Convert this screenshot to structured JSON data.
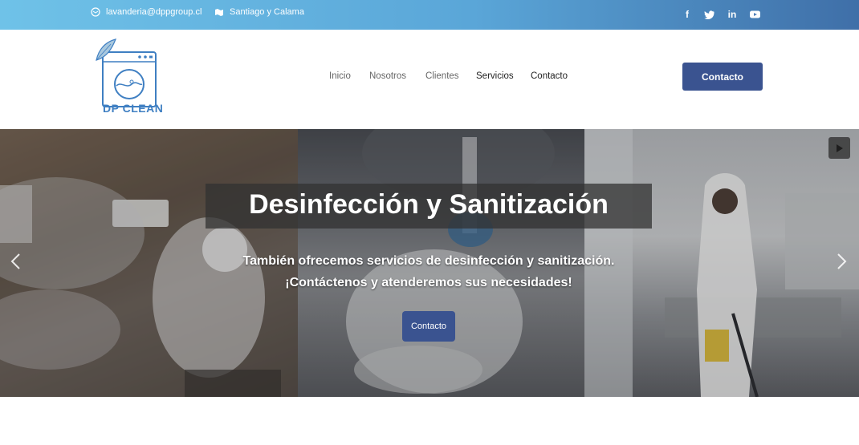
{
  "topbar": {
    "email": "lavanderia@dppgroup.cl",
    "location": "Santiago y Calama",
    "social": [
      "facebook-icon",
      "twitter-icon",
      "linkedin-icon",
      "youtube-icon"
    ]
  },
  "header": {
    "logo_text": "DP CLEAN",
    "nav": [
      "Inicio",
      "Nosotros",
      "Clientes",
      "Servicios",
      "Contacto"
    ],
    "cta": "Contacto"
  },
  "hero": {
    "title": "Desinfección y Sanitización",
    "subtitle_line1": "También ofrecemos servicios de desinfección y sanitización.",
    "subtitle_line2": "¡Contáctenos y atenderemos sus necesidades!",
    "button": "Contacto"
  },
  "colors": {
    "accent": "#3a5390",
    "logo_blue": "#3f7fc2"
  }
}
